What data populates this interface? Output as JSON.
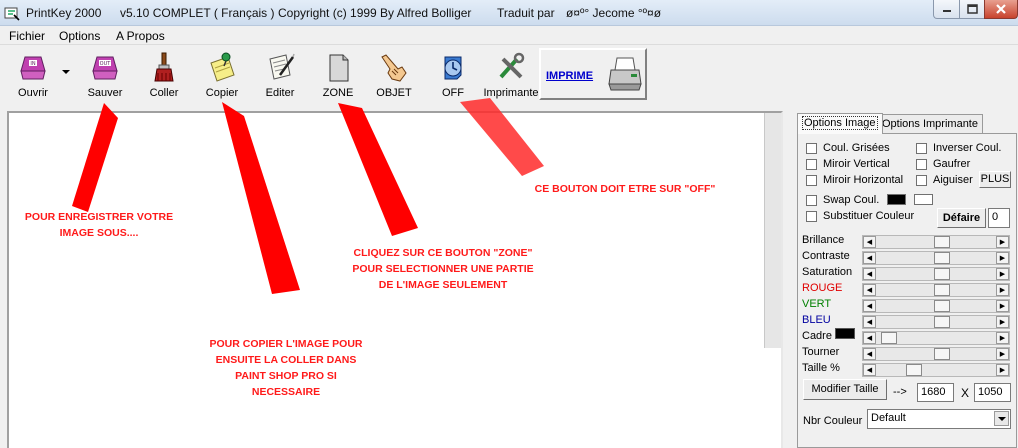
{
  "window": {
    "title_parts": [
      "PrintKey 2000",
      "v5.10 COMPLET ( Français )",
      "Copyright (c) 1999 By Alfred Bolliger",
      "Traduit par",
      "ø¤º° Jecome °º¤ø"
    ]
  },
  "menu": [
    "Fichier",
    "Options",
    "A Propos"
  ],
  "toolbar": {
    "buttons": [
      {
        "label": "Ouvrir",
        "icon": "open-in-icon"
      },
      {
        "label": "Sauver",
        "icon": "save-out-icon"
      },
      {
        "label": "Coller",
        "icon": "paste-brush-icon"
      },
      {
        "label": "Copier",
        "icon": "copy-note-icon"
      },
      {
        "label": "Editer",
        "icon": "edit-scroll-icon"
      },
      {
        "label": "ZONE",
        "icon": "zone-page-icon"
      },
      {
        "label": "OBJET",
        "icon": "pointing-hand-icon"
      },
      {
        "label": "OFF",
        "icon": "clock-timer-icon"
      },
      {
        "label": "Imprimante",
        "icon": "printer-tools-icon"
      }
    ],
    "imprime_label": "IMPRIME"
  },
  "annotations": {
    "enregistrer": [
      "POUR ENREGISTRER VOTRE",
      "IMAGE SOUS...."
    ],
    "copier": [
      "POUR COPIER L'IMAGE POUR",
      "ENSUITE LA COLLER DANS",
      "PAINT SHOP PRO SI",
      "NECESSAIRE"
    ],
    "zone": [
      "CLIQUEZ SUR CE BOUTON \"ZONE\"",
      "POUR SELECTIONNER UNE PARTIE",
      "DE L'IMAGE SEULEMENT"
    ],
    "off": [
      "CE BOUTON DOIT ETRE SUR \"OFF\""
    ],
    "color": "#ff1a1a"
  },
  "panel": {
    "tabs": [
      "Options Image",
      "Options Imprimante"
    ],
    "checkboxes": {
      "coul_grisees": "Coul. Grisées",
      "inverser_coul": "Inverser Coul.",
      "miroir_vertical": "Miroir Vertical",
      "gaufrer": "Gaufrer",
      "miroir_horizontal": "Miroir Horizontal",
      "aiguiser": "Aiguiser",
      "swap_coul": "Swap Coul.",
      "substituer_couleur": "Substituer Couleur"
    },
    "plus_label": "PLUS",
    "defaire_label": "Défaire",
    "defaire_value": "0",
    "sliders": [
      {
        "label": "Brillance",
        "color": "#000000",
        "value": 0.55
      },
      {
        "label": "Contraste",
        "color": "#000000",
        "value": 0.55
      },
      {
        "label": "Saturation",
        "color": "#000000",
        "value": 0.55
      },
      {
        "label": "ROUGE",
        "color": "#e00000",
        "value": 0.55
      },
      {
        "label": "VERT",
        "color": "#008000",
        "value": 0.55
      },
      {
        "label": "BLEU",
        "color": "#0000a0",
        "value": 0.55
      },
      {
        "label": "Cadre",
        "color": "#000000",
        "value": 0.05
      },
      {
        "label": "Tourner",
        "color": "#000000",
        "value": 0.55
      },
      {
        "label": "Taille %",
        "color": "#000000",
        "value": 0.28
      }
    ],
    "modifier_taille_label": "Modifier Taille",
    "arrow_text": "-->",
    "width_value": "1680",
    "times_text": "X",
    "height_value": "1050",
    "nbr_couleur_label": "Nbr Couleur",
    "nbr_couleur_value": "Default"
  }
}
